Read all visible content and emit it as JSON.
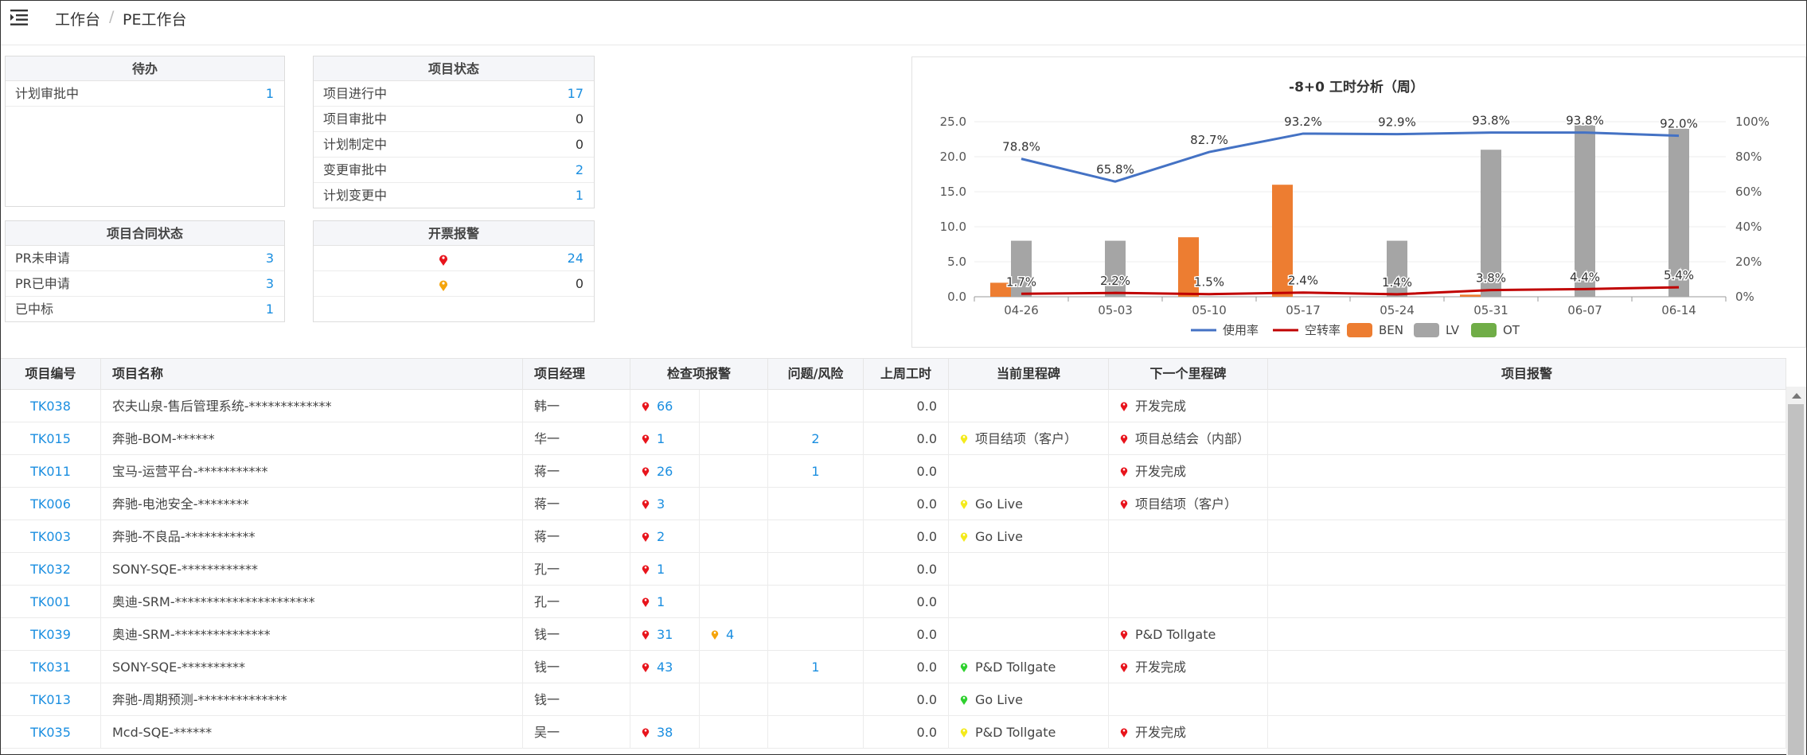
{
  "breadcrumb": {
    "home": "工作台",
    "separator": "/",
    "current": "PE工作台"
  },
  "colors": {
    "blue": "#1a8ee0",
    "red_pin": "#e8141c",
    "orange_pin": "#f5a40b",
    "yellow_pin": "#f4ea1c",
    "green_pin": "#2ed12e"
  },
  "todo": {
    "title": "待办",
    "rows": [
      {
        "label": "计划审批中",
        "value": "1"
      }
    ]
  },
  "project_status": {
    "title": "项目状态",
    "rows": [
      {
        "label": "项目进行中",
        "value": "17"
      },
      {
        "label": "项目审批中",
        "value": "0"
      },
      {
        "label": "计划制定中",
        "value": "0"
      },
      {
        "label": "变更审批中",
        "value": "2"
      },
      {
        "label": "计划变更中",
        "value": "1"
      }
    ]
  },
  "contract_status": {
    "title": "项目合同状态",
    "rows": [
      {
        "label": "PR未申请",
        "value": "3"
      },
      {
        "label": "PR已申请",
        "value": "3"
      },
      {
        "label": "已中标",
        "value": "1"
      }
    ]
  },
  "invoice_alert": {
    "title": "开票报警",
    "rows": [
      {
        "icon": "red-pin",
        "value": "24"
      },
      {
        "icon": "orange-pin",
        "value": "0"
      }
    ]
  },
  "chart_data": {
    "type": "bar",
    "title": "-8+0 工时分析（周）",
    "categories": [
      "04-26",
      "05-03",
      "05-10",
      "05-17",
      "05-24",
      "05-31",
      "06-07",
      "06-14"
    ],
    "ylim": [
      0,
      25
    ],
    "yticks": [
      "0.0",
      "5.0",
      "10.0",
      "15.0",
      "20.0",
      "25.0"
    ],
    "y2lim": [
      0,
      100
    ],
    "y2ticks": [
      "0%",
      "20%",
      "40%",
      "60%",
      "80%",
      "100%"
    ],
    "series": [
      {
        "name": "BEN",
        "kind": "bar",
        "color": "#ed7d31",
        "values": [
          2,
          0,
          8.5,
          16,
          0,
          0.3,
          0,
          0
        ]
      },
      {
        "name": "LV",
        "kind": "bar",
        "color": "#a5a5a5",
        "values": [
          8,
          8,
          0,
          0,
          8,
          21,
          24.5,
          24
        ]
      },
      {
        "name": "OT",
        "kind": "bar",
        "color": "#70ad47",
        "values": [
          0,
          0,
          0,
          0,
          0,
          0,
          0,
          0
        ]
      },
      {
        "name": "使用率",
        "kind": "line",
        "axis": "right",
        "color": "#4472c4",
        "values": [
          78.8,
          65.8,
          82.7,
          93.2,
          92.9,
          93.8,
          93.8,
          92.0
        ],
        "labels": [
          "78.8%",
          "65.8%",
          "82.7%",
          "93.2%",
          "92.9%",
          "93.8%",
          "93.8%",
          "92.0%"
        ]
      },
      {
        "name": "空转率",
        "kind": "line",
        "axis": "right",
        "color": "#c00000",
        "values": [
          1.7,
          2.2,
          1.5,
          2.4,
          1.4,
          3.8,
          4.4,
          5.4
        ],
        "labels": [
          "1.7%",
          "2.2%",
          "1.5%",
          "2.4%",
          "1.4%",
          "3.8%",
          "4.4%",
          "5.4%"
        ]
      }
    ],
    "legend_order": [
      "使用率",
      "空转率",
      "BEN",
      "LV",
      "OT"
    ],
    "legend_placement": "bottom"
  },
  "table": {
    "headers": [
      "项目编号",
      "项目名称",
      "项目经理",
      "检查项报警",
      "问题/风险",
      "上周工时",
      "当前里程碑",
      "下一个里程碑",
      "项目报警"
    ],
    "rows": [
      {
        "id": "TK038",
        "name": "农夫山泉-售后管理系统-*************",
        "manager": "韩一",
        "check1": {
          "icon": "red",
          "value": "66"
        },
        "check2": null,
        "issue": "",
        "hours": "0.0",
        "current": null,
        "next": {
          "icon": "red",
          "text": "开发完成"
        }
      },
      {
        "id": "TK015",
        "name": "奔驰-BOM-******",
        "manager": "华一",
        "check1": {
          "icon": "red",
          "value": "1"
        },
        "check2": null,
        "issue": "2",
        "hours": "0.0",
        "current": {
          "icon": "yellow",
          "text": "项目结项（客户）"
        },
        "next": {
          "icon": "red",
          "text": "项目总结会（内部）"
        }
      },
      {
        "id": "TK011",
        "name": "宝马-运营平台-***********",
        "manager": "蒋一",
        "check1": {
          "icon": "red",
          "value": "26"
        },
        "check2": null,
        "issue": "1",
        "hours": "0.0",
        "current": null,
        "next": {
          "icon": "red",
          "text": "开发完成"
        }
      },
      {
        "id": "TK006",
        "name": "奔驰-电池安全-********",
        "manager": "蒋一",
        "check1": {
          "icon": "red",
          "value": "3"
        },
        "check2": null,
        "issue": "",
        "hours": "0.0",
        "current": {
          "icon": "yellow",
          "text": "Go Live"
        },
        "next": {
          "icon": "red",
          "text": "项目结项（客户）"
        }
      },
      {
        "id": "TK003",
        "name": "奔驰-不良品-***********",
        "manager": "蒋一",
        "check1": {
          "icon": "red",
          "value": "2"
        },
        "check2": null,
        "issue": "",
        "hours": "0.0",
        "current": {
          "icon": "yellow",
          "text": "Go Live"
        },
        "next": null
      },
      {
        "id": "TK032",
        "name": "SONY-SQE-************",
        "manager": "孔一",
        "check1": {
          "icon": "red",
          "value": "1"
        },
        "check2": null,
        "issue": "",
        "hours": "0.0",
        "current": null,
        "next": null
      },
      {
        "id": "TK001",
        "name": "奥迪-SRM-**********************",
        "manager": "孔一",
        "check1": {
          "icon": "red",
          "value": "1"
        },
        "check2": null,
        "issue": "",
        "hours": "0.0",
        "current": null,
        "next": null
      },
      {
        "id": "TK039",
        "name": "奥迪-SRM-***************",
        "manager": "钱一",
        "check1": {
          "icon": "red",
          "value": "31"
        },
        "check2": {
          "icon": "orange",
          "value": "4"
        },
        "issue": "",
        "hours": "0.0",
        "current": null,
        "next": {
          "icon": "red",
          "text": "P&D Tollgate"
        }
      },
      {
        "id": "TK031",
        "name": "SONY-SQE-**********",
        "manager": "钱一",
        "check1": {
          "icon": "red",
          "value": "43"
        },
        "check2": null,
        "issue": "1",
        "hours": "0.0",
        "current": {
          "icon": "green",
          "text": "P&D Tollgate"
        },
        "next": {
          "icon": "red",
          "text": "开发完成"
        }
      },
      {
        "id": "TK013",
        "name": "奔驰-周期预测-**************",
        "manager": "钱一",
        "check1": null,
        "check2": null,
        "issue": "",
        "hours": "0.0",
        "current": {
          "icon": "green",
          "text": "Go Live"
        },
        "next": null
      },
      {
        "id": "TK035",
        "name": "Mcd-SQE-******",
        "manager": "吴一",
        "check1": {
          "icon": "red",
          "value": "38"
        },
        "check2": null,
        "issue": "",
        "hours": "0.0",
        "current": {
          "icon": "yellow",
          "text": "P&D Tollgate"
        },
        "next": {
          "icon": "red",
          "text": "开发完成"
        }
      }
    ]
  }
}
